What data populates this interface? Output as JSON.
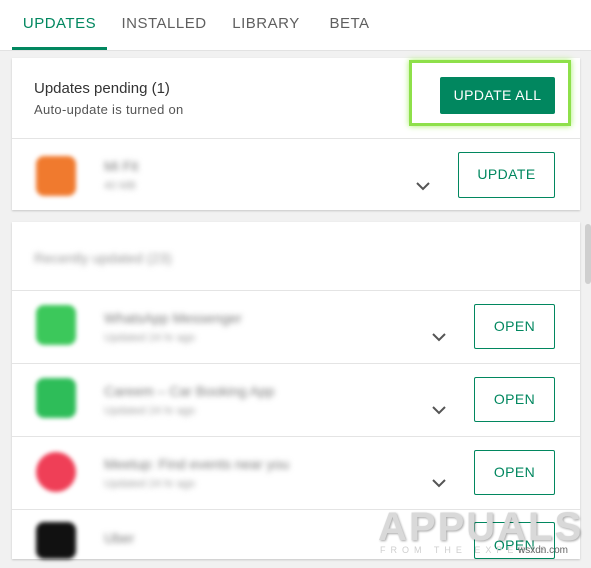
{
  "tabs": [
    {
      "label": "UPDATES",
      "active": true
    },
    {
      "label": "INSTALLED",
      "active": false
    },
    {
      "label": "LIBRARY",
      "active": false
    },
    {
      "label": "BETA",
      "active": false
    }
  ],
  "pending": {
    "title": "Updates pending (1)",
    "subtitle": "Auto-update is turned on",
    "update_all_label": "UPDATE ALL"
  },
  "pending_app": {
    "name": "Mi Fit",
    "size": "40 MB",
    "icon_color": "#f07a2e",
    "button_label": "UPDATE"
  },
  "recent": {
    "header": "Recently updated (23)",
    "items": [
      {
        "name": "WhatsApp Messenger",
        "sub": "Updated 24 hr ago",
        "icon_color": "#3cc85b",
        "button_label": "OPEN"
      },
      {
        "name": "Careem – Car Booking App",
        "sub": "Updated 24 hr ago",
        "icon_color": "#2ebd59",
        "button_label": "OPEN"
      },
      {
        "name": "Meetup: Find events near you",
        "sub": "Updated 24 hr ago",
        "icon_color": "#ef3f57",
        "button_label": "OPEN"
      },
      {
        "name": "Uber",
        "sub": "Updated 24 hr ago",
        "icon_color": "#111111",
        "button_label": "OPEN"
      }
    ]
  },
  "watermark": {
    "brand": "APPUALS",
    "tagline": "FROM THE EXPERTS",
    "site": "wsxdn.com"
  },
  "colors": {
    "accent": "#01875f",
    "highlight": "#8ee04a"
  }
}
